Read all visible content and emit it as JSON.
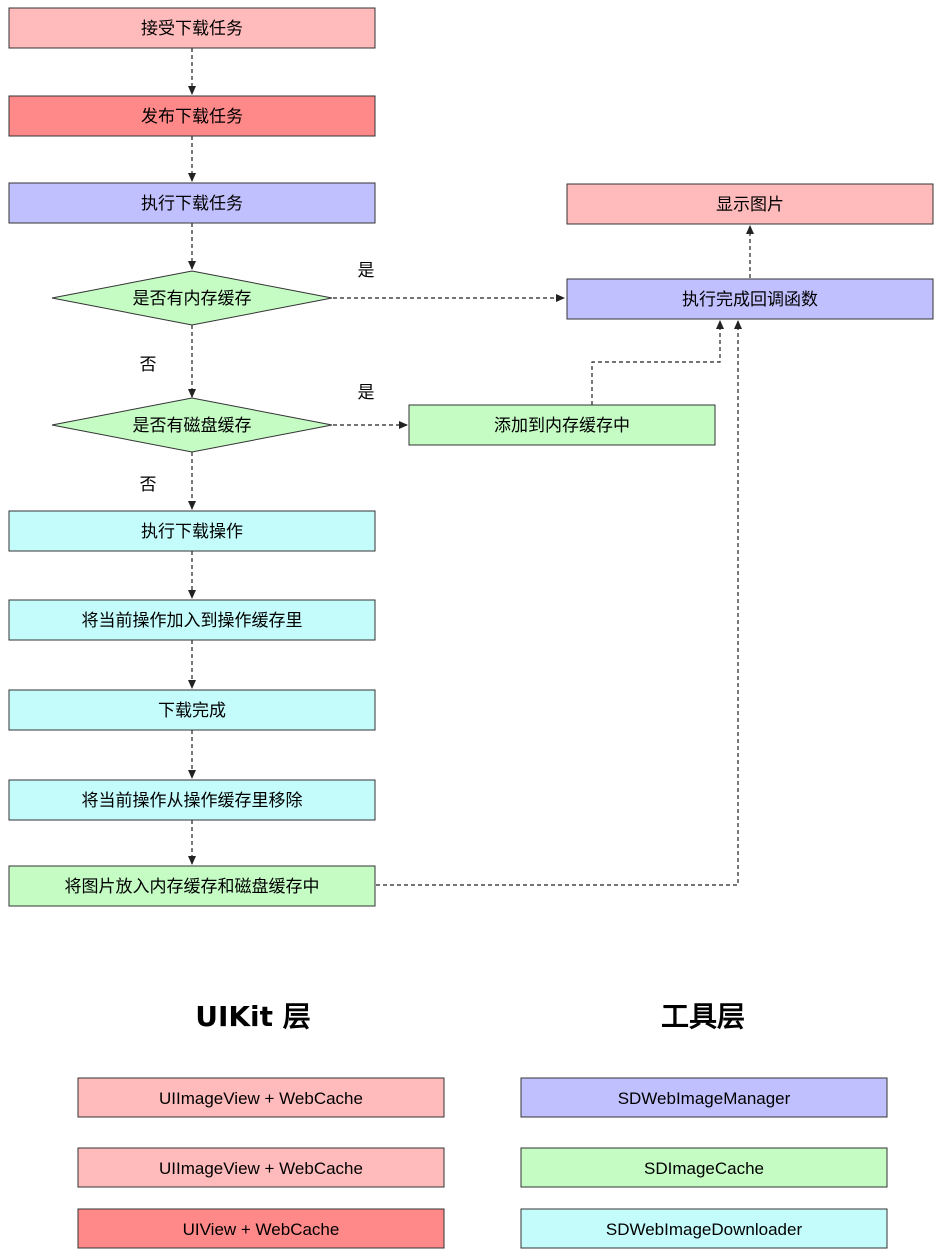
{
  "colors": {
    "pink": "#FFBBBB",
    "red": "#FF8888",
    "purple": "#C0C0FF",
    "green": "#C4FCC4",
    "cyan": "#C4FCFC",
    "diamond_green": "#C4FCC4",
    "stroke": "#333333"
  },
  "flow": {
    "receive_task": "接受下载任务",
    "publish_task": "发布下载任务",
    "execute_task": "执行下载任务",
    "check_memory": "是否有内存缓存",
    "check_disk": "是否有磁盘缓存",
    "download_op": "执行下载操作",
    "add_to_op_cache": "将当前操作加入到操作缓存里",
    "download_done": "下载完成",
    "remove_from_op_cache": "将当前操作从操作缓存里移除",
    "store_image": "将图片放入内存缓存和磁盘缓存中",
    "show_image": "显示图片",
    "completion_callback": "执行完成回调函数",
    "add_to_memory": "添加到内存缓存中"
  },
  "edge_labels": {
    "memory_yes": "是",
    "memory_no": "否",
    "disk_yes": "是",
    "disk_no": "否"
  },
  "legend": {
    "uikit_heading": "UIKit 层",
    "tools_heading": "工具层",
    "uikit_items": [
      {
        "label": "UIImageView + WebCache",
        "color": "#FFBBBB"
      },
      {
        "label": "UIImageView + WebCache",
        "color": "#FFBBBB"
      },
      {
        "label": "UIView + WebCache",
        "color": "#FF8888"
      }
    ],
    "tools_items": [
      {
        "label": "SDWebImageManager",
        "color": "#C0C0FF"
      },
      {
        "label": "SDImageCache",
        "color": "#C4FCC4"
      },
      {
        "label": "SDWebImageDownloader",
        "color": "#C4FCFC"
      }
    ]
  }
}
